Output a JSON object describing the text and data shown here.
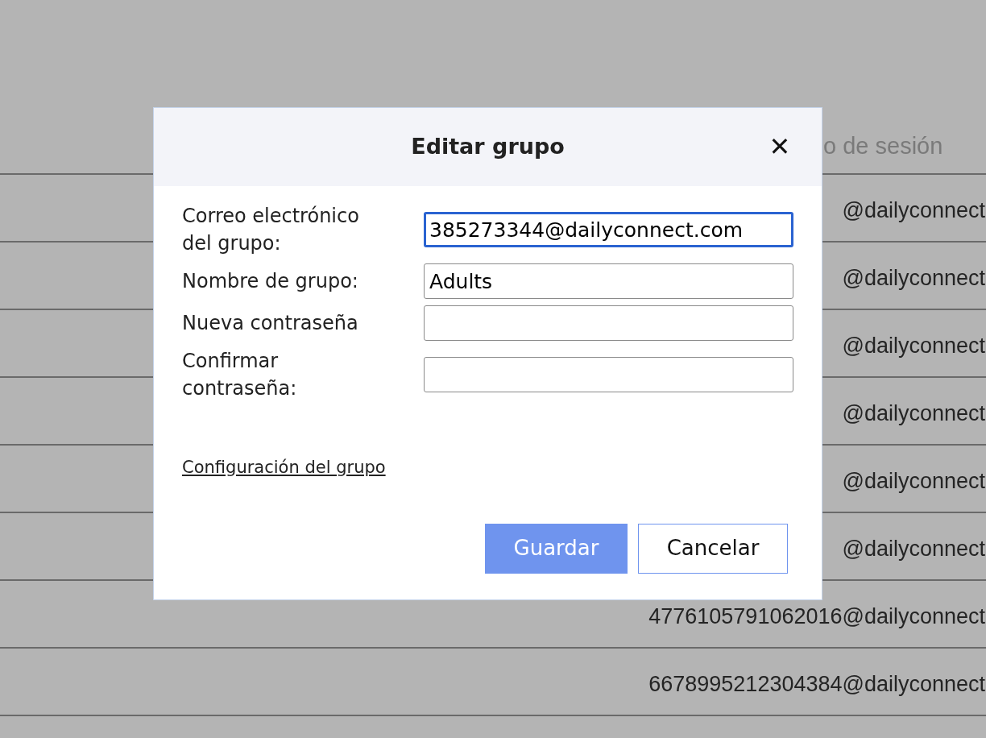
{
  "table": {
    "column_header": "o de sesión",
    "rows": [
      {
        "login": "@dailyconnect"
      },
      {
        "login": "@dailyconnect"
      },
      {
        "login": "@dailyconnect"
      },
      {
        "login": "@dailyconnect"
      },
      {
        "login": "@dailyconnect"
      },
      {
        "login": "@dailyconnect"
      },
      {
        "login": "4776105791062016@dailyconnect"
      },
      {
        "login": "6678995212304384@dailyconnect"
      }
    ]
  },
  "dialog": {
    "title": "Editar grupo",
    "close": "✕",
    "fields": [
      {
        "label": "Correo electrónico del grupo:",
        "value": "385273344@dailyconnect.com",
        "focused": true
      },
      {
        "label": "Nombre de grupo:",
        "value": "Adults",
        "focused": false
      },
      {
        "label": "Nueva contraseña",
        "focused": false
      },
      {
        "label": "Confirmar contraseña:",
        "focused": false
      }
    ],
    "link": "Configuración del grupo",
    "buttons": [
      {
        "label": "Guardar",
        "kind": "primary"
      },
      {
        "label": "Cancelar",
        "kind": "secondary"
      }
    ]
  }
}
